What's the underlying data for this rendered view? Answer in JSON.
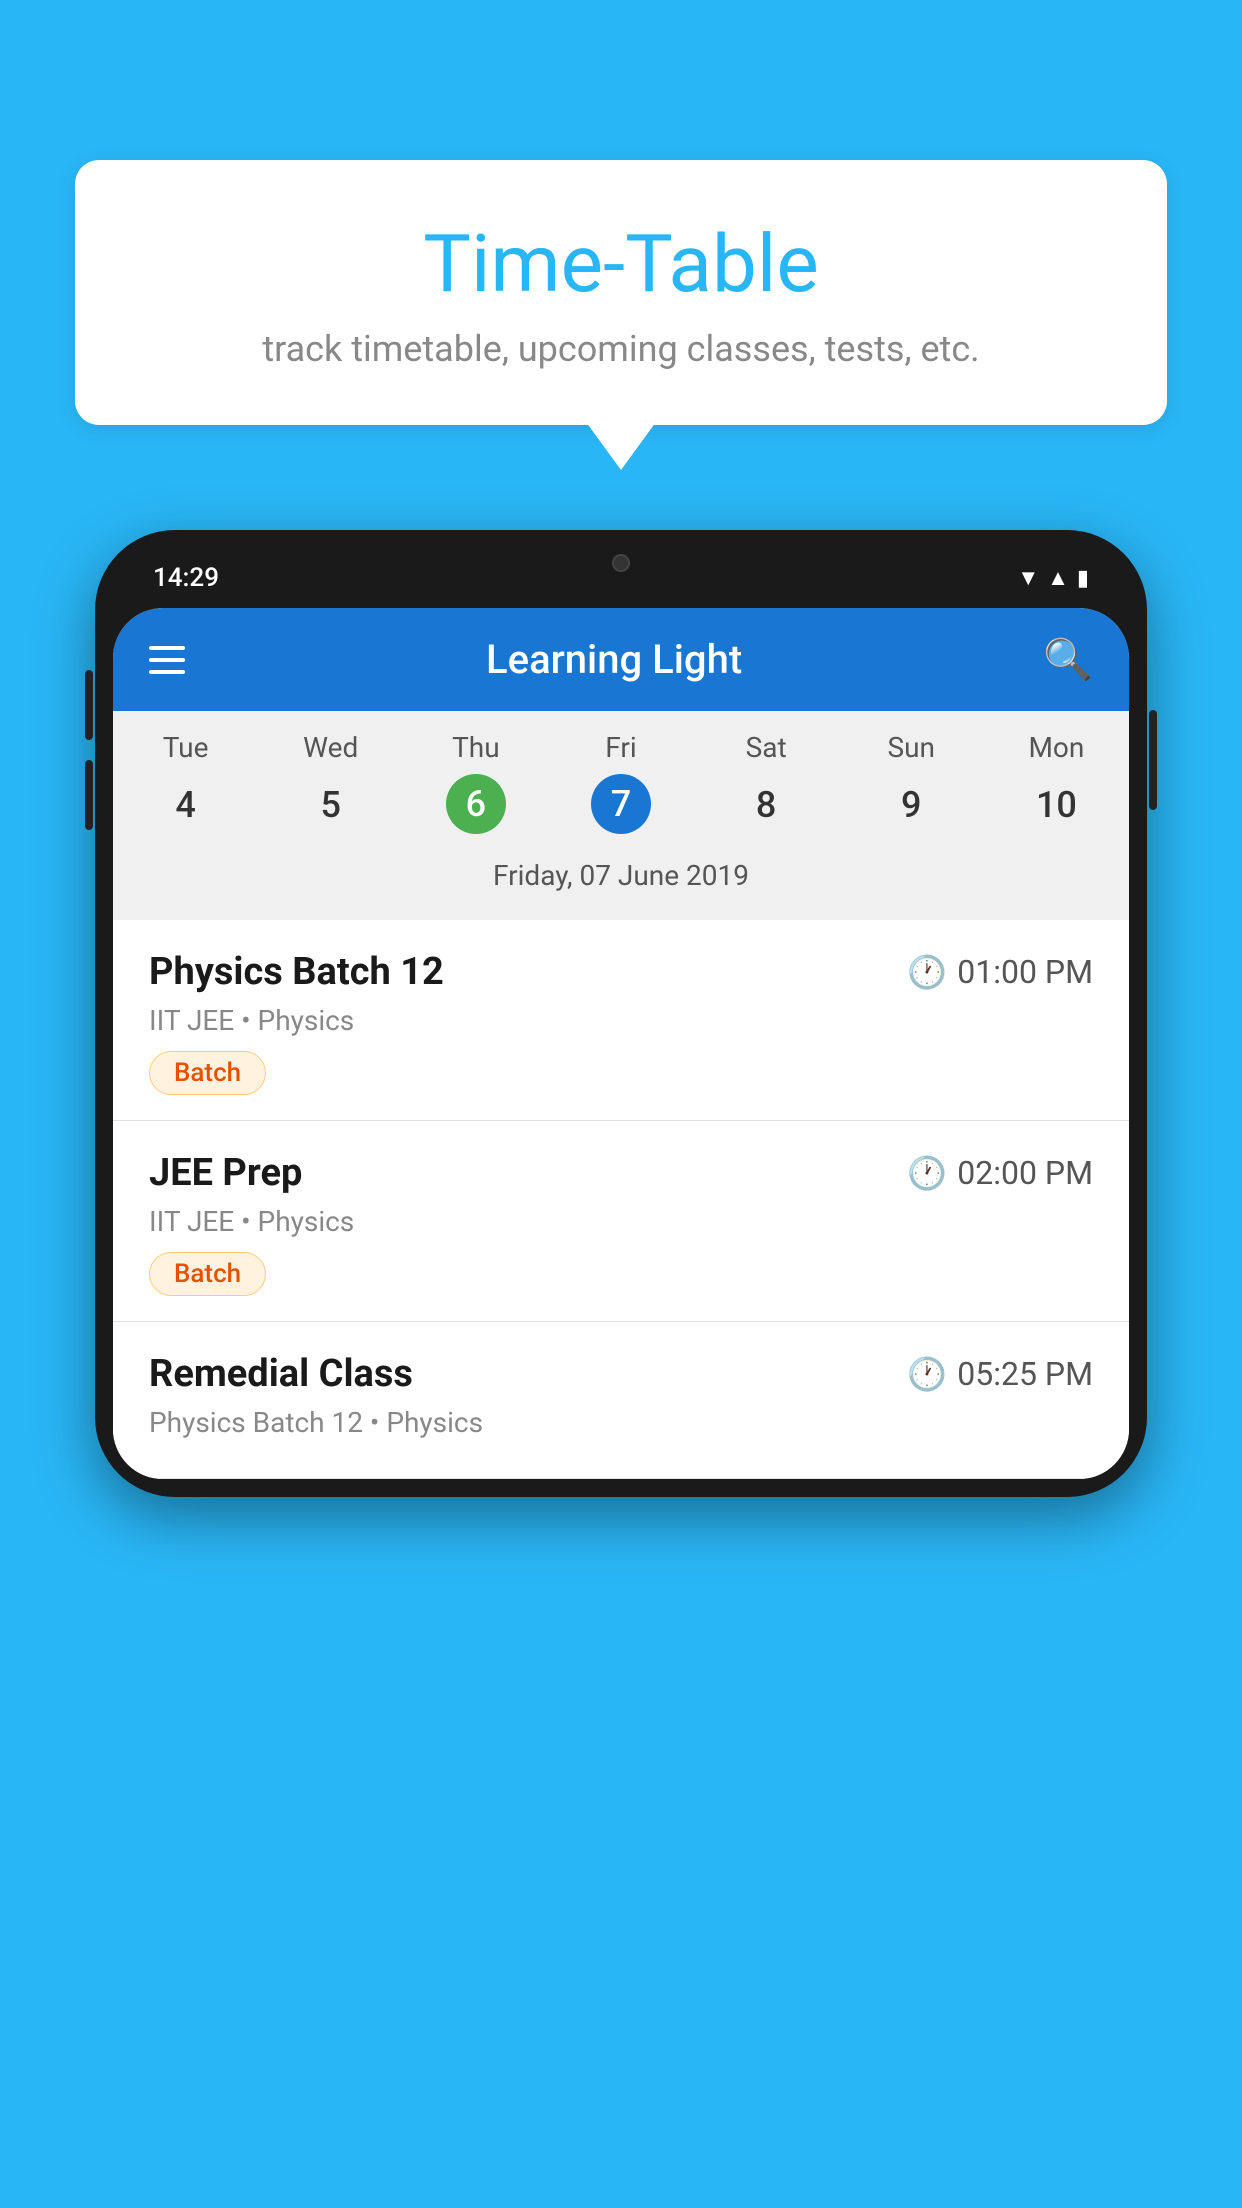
{
  "background_color": "#29B6F6",
  "bubble": {
    "title": "Time-Table",
    "subtitle": "track timetable, upcoming classes, tests, etc."
  },
  "phone": {
    "time": "14:29",
    "app_title": "Learning Light",
    "selected_date_label": "Friday, 07 June 2019",
    "days": [
      {
        "short": "Tue",
        "num": "4"
      },
      {
        "short": "Wed",
        "num": "5"
      },
      {
        "short": "Thu",
        "num": "6",
        "state": "today"
      },
      {
        "short": "Fri",
        "num": "7",
        "state": "selected"
      },
      {
        "short": "Sat",
        "num": "8"
      },
      {
        "short": "Sun",
        "num": "9"
      },
      {
        "short": "Mon",
        "num": "10"
      }
    ],
    "schedule": [
      {
        "name": "Physics Batch 12",
        "time": "01:00 PM",
        "meta": "IIT JEE • Physics",
        "tag": "Batch"
      },
      {
        "name": "JEE Prep",
        "time": "02:00 PM",
        "meta": "IIT JEE • Physics",
        "tag": "Batch"
      },
      {
        "name": "Remedial Class",
        "time": "05:25 PM",
        "meta": "Physics Batch 12 • Physics",
        "tag": ""
      }
    ]
  }
}
